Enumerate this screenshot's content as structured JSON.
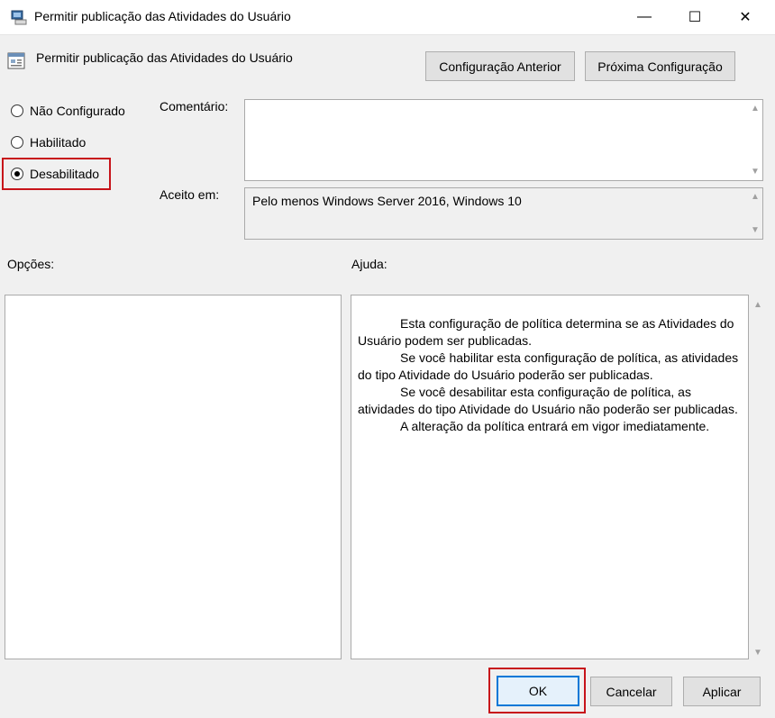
{
  "window": {
    "title": "Permitir publicação das Atividades do Usuário",
    "controls": {
      "minimize": "—",
      "maximize": "☐",
      "close": "✕"
    }
  },
  "header": {
    "policy_name": "Permitir publicação das Atividades do Usuário",
    "icon": "policy-settings-icon",
    "prev_button": "Configuração Anterior",
    "next_button": "Próxima Configuração"
  },
  "state": {
    "options": [
      {
        "label": "Não Configurado",
        "checked": false
      },
      {
        "label": "Habilitado",
        "checked": false
      },
      {
        "label": "Desabilitado",
        "checked": true
      }
    ]
  },
  "comment": {
    "label": "Comentário:",
    "value": ""
  },
  "supported": {
    "label": "Aceito em:",
    "value": "Pelo menos Windows Server 2016, Windows 10"
  },
  "sections": {
    "options_label": "Opções:",
    "help_label": "Ajuda:"
  },
  "help": {
    "lines": [
      "Esta configuração de política determina se as Atividades do Usuário podem ser publicadas.",
      "Se você habilitar esta configuração de política, as atividades do tipo Atividade do Usuário poderão ser publicadas.",
      "Se você desabilitar esta configuração de política, as atividades do tipo Atividade do Usuário não poderão ser publicadas.",
      "A alteração da política entrará em vigor imediatamente."
    ]
  },
  "footer": {
    "ok": "OK",
    "cancel": "Cancelar",
    "apply": "Aplicar"
  },
  "colors": {
    "highlight": "#c7141a",
    "focus": "#0078d7"
  }
}
